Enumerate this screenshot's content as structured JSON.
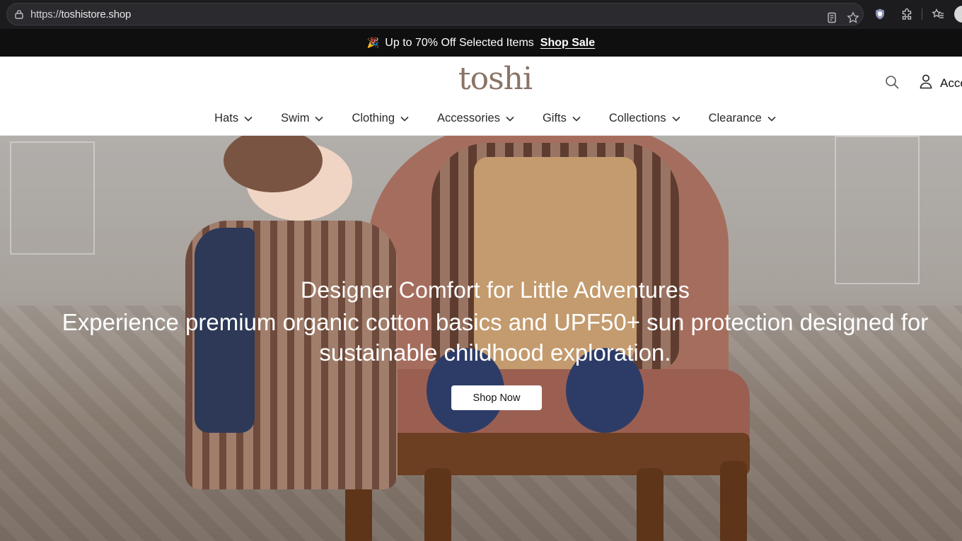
{
  "browser": {
    "url_scheme": "https://",
    "url_host": "toshistore.shop"
  },
  "announcement": {
    "emoji": "🎉",
    "text": "Up to 70% Off Selected Items",
    "link": "Shop Sale"
  },
  "header": {
    "logo": "toshi",
    "account_label": "Account"
  },
  "nav": {
    "items": [
      {
        "label": "Hats"
      },
      {
        "label": "Swim"
      },
      {
        "label": "Clothing"
      },
      {
        "label": "Accessories"
      },
      {
        "label": "Gifts"
      },
      {
        "label": "Collections"
      },
      {
        "label": "Clearance"
      }
    ]
  },
  "hero": {
    "title": "Designer Comfort for Little Adventures",
    "subtitle": "Experience premium organic cotton basics and UPF50+ sun protection designed for sustainable childhood exploration.",
    "cta": "Shop Now"
  }
}
